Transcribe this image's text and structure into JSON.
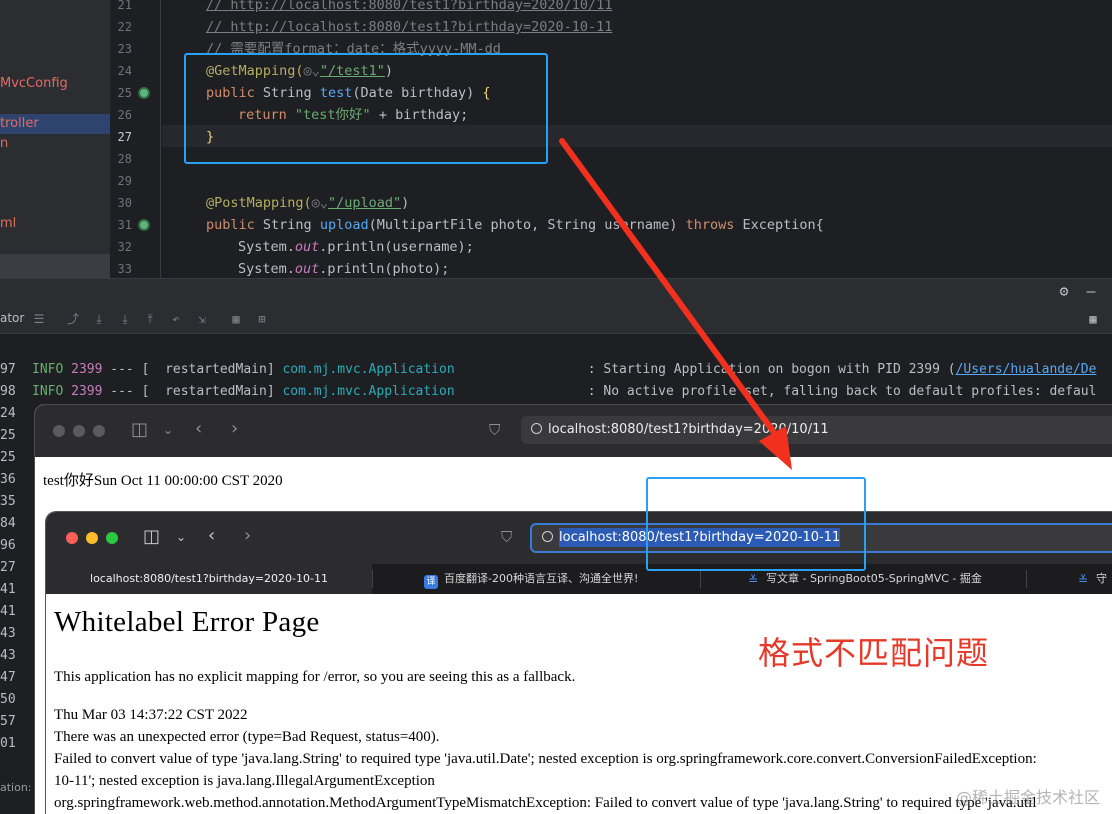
{
  "sidebar": {
    "items": [
      {
        "label": "MvcConfig"
      },
      {
        "label": "troller"
      },
      {
        "label": "n"
      },
      {
        "label": "ml"
      }
    ]
  },
  "editor": {
    "line_numbers": [
      "21",
      "22",
      "23",
      "24",
      "25",
      "26",
      "27",
      "28",
      "29",
      "30",
      "31",
      "32",
      "33"
    ],
    "comment1": "// http://localhost:8080/test1?birthday=2020/10/11",
    "comment2": "// http://localhost:8080/test1?birthday=2020-10-11",
    "comment3": "// 需要配置format：date：格式yyyy-MM-dd",
    "annotation_get": "@GetMapping(",
    "path_test1": "\"/test1\"",
    "sig_public": "public",
    "sig_string": " String ",
    "sig_method": "test",
    "sig_params": "(Date birthday) ",
    "kw_return": "return",
    "return_str": "\"test你好\"",
    "return_rest": " + birthday;",
    "annotation_post": "@PostMapping(",
    "path_upload": "\"/upload\"",
    "upload_method": "upload",
    "upload_params": "(MultipartFile photo, String username) ",
    "kw_throws": "throws",
    "upload_rest": " Exception{",
    "print1_a": "System.",
    "print1_out": "out",
    "print1_b": ".println(username);",
    "print2_b": ".println(photo);"
  },
  "run_toolbar": {
    "label": "ator"
  },
  "console": {
    "line_numbers": [
      "97",
      "98",
      "24",
      "25",
      "25",
      "36",
      "35",
      "84",
      "96",
      "27",
      "41",
      "41",
      "43",
      "43",
      "47",
      "50",
      "57",
      "01"
    ],
    "line1": {
      "level": "INFO",
      "pid": "2399",
      "sep": " --- [  restartedMain] ",
      "logger": "com.mj.mvc.Application",
      "msg": "                 : Starting Application on bogon with PID 2399 (",
      "path": "/Users/hualande/De"
    },
    "line2": {
      "level": "INFO",
      "pid": "2399",
      "sep": " --- [  restartedMain] ",
      "logger": "com.mj.mvc.Application",
      "msg": "                 : No active profile set, falling back to default profiles: defaul"
    },
    "bottom_label": "ation:"
  },
  "browser1": {
    "url": "localhost:8080/test1?birthday=2020/10/11",
    "body_text": "test你好Sun Oct 11 00:00:00 CST 2020"
  },
  "browser2": {
    "url": "localhost:8080/test1?birthday=2020-10-11",
    "tabs": [
      {
        "label": "localhost:8080/test1?birthday=2020-10-11"
      },
      {
        "label": "百度翻译-200种语言互译、沟通全世界!"
      },
      {
        "label": "写文章 - SpringBoot05-SpringMVC - 掘金"
      },
      {
        "label": "守"
      }
    ],
    "heading": "Whitelabel Error Page",
    "p1": "This application has no explicit mapping for /error, so you are seeing this as a fallback.",
    "timestamp": "Thu Mar 03 14:37:22 CST 2022",
    "p2": "There was an unexpected error (type=Bad Request, status=400).",
    "p3": "Failed to convert value of type 'java.lang.String' to required type 'java.util.Date'; nested exception is org.springframework.core.convert.ConversionFailedException:",
    "p4": "10-11'; nested exception is java.lang.IllegalArgumentException",
    "p5": "org.springframework.web.method.annotation.MethodArgumentTypeMismatchException: Failed to convert value of type 'java.lang.String' to required type 'java.util"
  },
  "annotation_text": "格式不匹配问题",
  "watermark": "@稀土掘金技术社区",
  "colors": {
    "highlight_box": "#2aa0f0",
    "arrow": "#f2301e",
    "annotation": "#e5392a"
  }
}
